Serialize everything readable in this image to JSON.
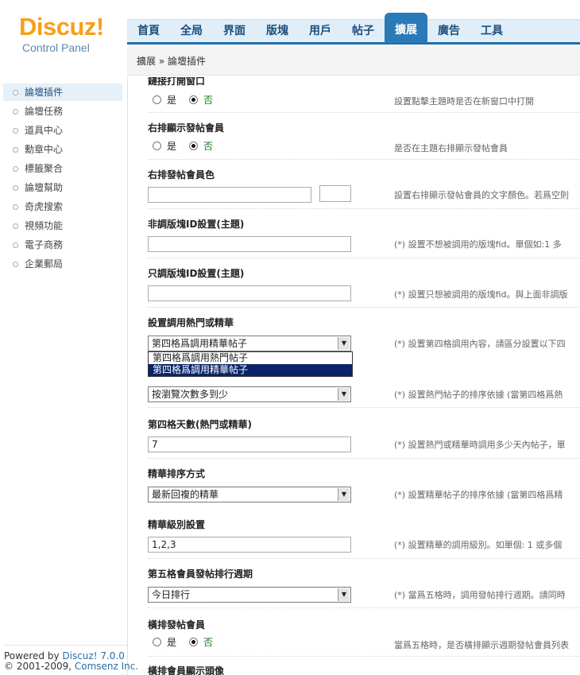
{
  "logo": {
    "word": "Discuz!",
    "sub": "Control Panel"
  },
  "nav": {
    "items": [
      "首頁",
      "全局",
      "界面",
      "版塊",
      "用戶",
      "帖子",
      "擴展",
      "廣告",
      "工具"
    ],
    "active": "擴展"
  },
  "breadcrumb": "擴展 » 論壇插件",
  "sidebar": {
    "items": [
      "論壇插件",
      "論壇任務",
      "道具中心",
      "勳章中心",
      "標籤聚合",
      "論壇幫助",
      "奇虎搜索",
      "視頻功能",
      "電子商務",
      "企業郵局"
    ],
    "active": "論壇插件",
    "powered_prefix": "Powered by ",
    "powered_brand": "Discuz! 7.0.0",
    "copyright_prefix": "© 2001-2009, ",
    "copyright_brand": "Comsenz Inc."
  },
  "settings": {
    "yes_label": "是",
    "no_label": "否",
    "new_window": {
      "title": "鏈接打開窗口",
      "desc": "設置點擊主題時是否在新窗口中打開"
    },
    "right_poster": {
      "title": "右排顯示發帖會員",
      "desc": "是否在主題右排顯示發帖會員"
    },
    "right_poster_color": {
      "title": "右排發帖會員色",
      "desc": "設置右排顯示發帖會員的文字顏色。若爲空則"
    },
    "exclude_forum": {
      "title": "非調版塊ID設置(主題)",
      "desc": "(*) 設置不想被調用的版塊fid。單個如:1 多"
    },
    "only_forum": {
      "title": "只調版塊ID設置(主題)",
      "desc": "(*) 設置只想被調用的版塊fid。與上面非調版"
    },
    "hot_digest": {
      "title": "設置調用熱門或精華",
      "value": "第四格爲調用精華帖子",
      "desc": "(*) 設置第四格調用內容，請區分設置以下四",
      "options": [
        "第四格爲調用熱門帖子",
        "第四格爲調用精華帖子"
      ],
      "selected_option": "第四格爲調用精華帖子"
    },
    "hot_sort": {
      "value": "按瀏覽次數多到少",
      "desc": "(*) 設置熱門帖子的排序依據 (當第四格爲熱"
    },
    "days": {
      "title": "第四格天數(熱門或精華)",
      "value": "7",
      "desc": "(*) 設置熱門或精華時調用多少天內帖子，單"
    },
    "digest_sort": {
      "title": "精華排序方式",
      "value": "最新回複的精華",
      "desc": "(*) 設置精華帖子的排序依據 (當第四格爲精"
    },
    "digest_level": {
      "title": "精華級別設置",
      "value": "1,2,3",
      "desc": "(*) 設置精華的調用級別。如單個: 1 或多個"
    },
    "cycle": {
      "title": "第五格會員發帖排行週期",
      "value": "今日排行",
      "desc": "(*) 當爲五格時，調用發帖排行週期。請同時"
    },
    "row_poster": {
      "title": "橫排發帖會員",
      "desc": "當爲五格時，是否橫排顯示週期發帖會員列表"
    },
    "row_avatar": {
      "title": "橫排會員顯示頭像"
    }
  }
}
